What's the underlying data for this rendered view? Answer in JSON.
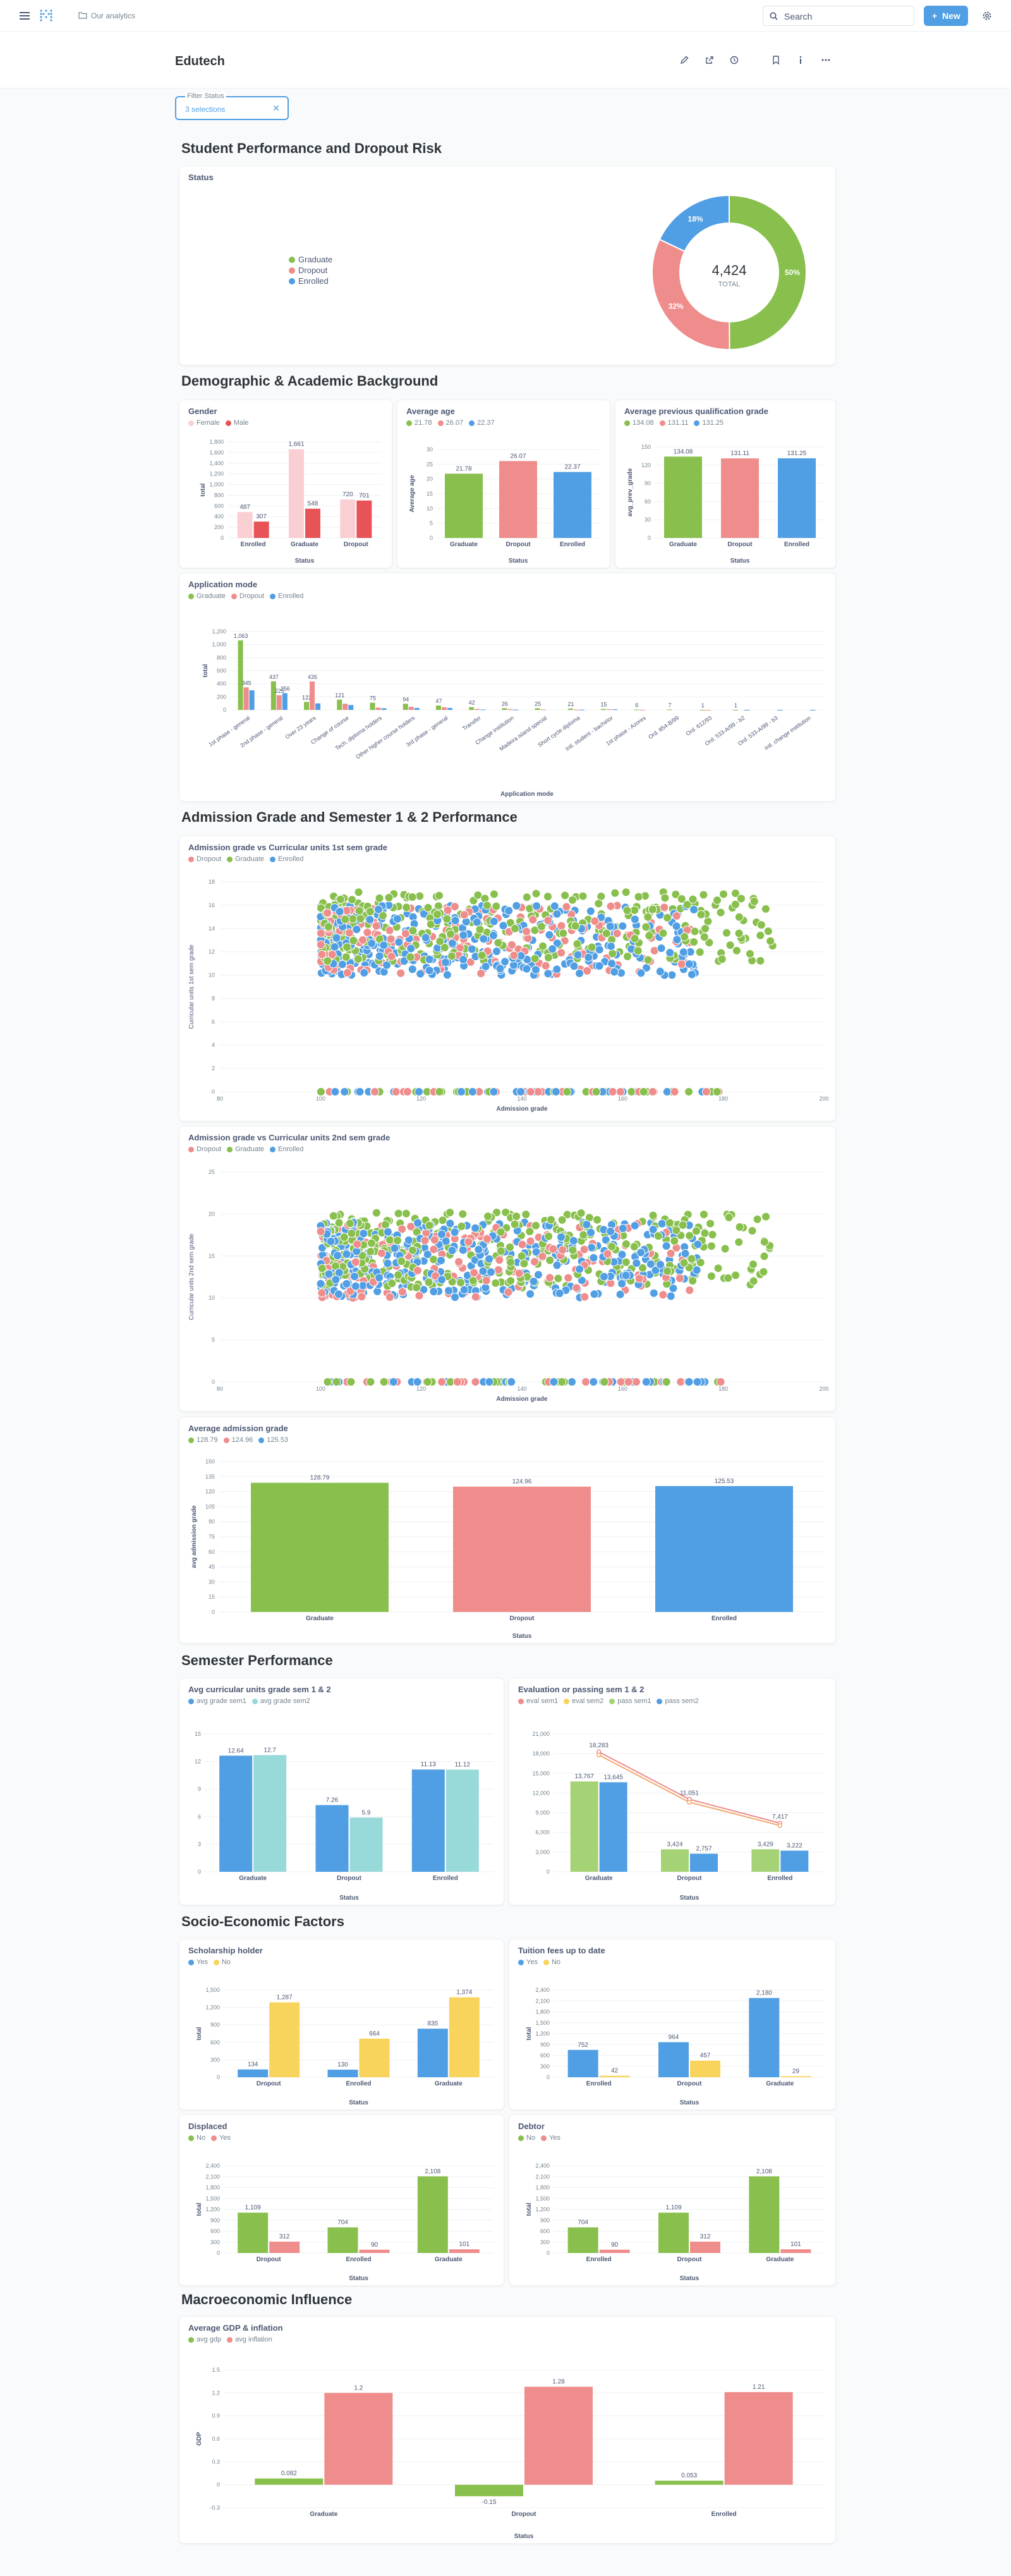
{
  "nav": {
    "breadcrumb": "Our analytics",
    "search_label": "Search",
    "new_label": "New",
    "logo_icon": "metabase-logo-icon",
    "menu_icon": "hamburger-icon",
    "settings_icon": "gear-icon",
    "folder_icon": "folder-icon"
  },
  "dashboard": {
    "title": "Edutech",
    "icons": [
      "pencil-icon",
      "share-icon",
      "clock-icon",
      "bookmark-icon",
      "info-icon",
      "more-icon"
    ]
  },
  "filter": {
    "label": "Filter Status",
    "value": "3 selections",
    "clear_icon": "close-icon"
  },
  "colors": {
    "graduate": "#88bf4d",
    "dropout": "#ef8c8c",
    "enrolled": "#509ee3",
    "enrolled_light": "#98d9d9",
    "female": "#f9cfd3",
    "male": "#e75356",
    "yes": "#509ee3",
    "no": "#f9d45c",
    "yes_green": "#88bf4d",
    "no_red": "#ef8c8c"
  },
  "sections": {
    "s1": "Student Performance and Dropout Risk",
    "s2": "Demographic & Academic Background",
    "s3": "Admission Grade and Semester 1 & 2 Performance",
    "s4": "Semester Performance",
    "s5": "Socio-Economic Factors",
    "s6": "Macroeconomic Influence"
  },
  "charts": [
    {
      "id": "status",
      "title": "Status",
      "type": "pie",
      "labels": [
        "Graduate",
        "Dropout",
        "Enrolled"
      ],
      "values": [
        2209,
        1421,
        794
      ],
      "percent_labels": [
        "50%",
        "32%",
        "18%"
      ],
      "total": "4,424",
      "total_label": "TOTAL"
    },
    {
      "id": "gender",
      "title": "Gender",
      "type": "bar",
      "legend": [
        "Female",
        "Male"
      ],
      "categories": [
        "Enrolled",
        "Graduate",
        "Dropout"
      ],
      "series": [
        {
          "name": "Female",
          "values": [
            487,
            1661,
            720
          ]
        },
        {
          "name": "Male",
          "values": [
            307,
            548,
            701
          ]
        }
      ],
      "value_labels": [
        [
          "487",
          "1,661",
          "720"
        ],
        [
          "307",
          "548",
          "701"
        ]
      ],
      "yticks": [
        0,
        200,
        400,
        600,
        800,
        1000,
        1200,
        1400,
        1600,
        1800
      ],
      "ytick_labels": [
        "0",
        "200",
        "400",
        "600",
        "800",
        "1,000",
        "1,200",
        "1,400",
        "1,600",
        "1,800"
      ],
      "ylabel": "total",
      "xlabel": "Status"
    },
    {
      "id": "avg_age",
      "title": "Average age",
      "type": "bar",
      "legend": [
        "21.78",
        "26.07",
        "22.37"
      ],
      "categories": [
        "Graduate",
        "Dropout",
        "Enrolled"
      ],
      "values": [
        21.78,
        26.07,
        22.37
      ],
      "value_labels": [
        "21.78",
        "26.07",
        "22.37"
      ],
      "yticks": [
        0,
        5,
        10,
        15,
        20,
        25,
        30
      ],
      "ylabel": "Average age",
      "xlabel": "Status"
    },
    {
      "id": "prev_qual",
      "title": "Average previous qualification grade",
      "type": "bar",
      "legend": [
        "134.08",
        "131.11",
        "131.25"
      ],
      "categories": [
        "Graduate",
        "Dropout",
        "Enrolled"
      ],
      "values": [
        134.08,
        131.11,
        131.25
      ],
      "value_labels": [
        "134.08",
        "131.11",
        "131.25"
      ],
      "yticks": [
        0,
        30,
        60,
        90,
        120,
        150
      ],
      "ylabel": "avg_prev_grade",
      "xlabel": "Status"
    },
    {
      "id": "app_mode",
      "title": "Application mode",
      "type": "bar",
      "legend": [
        "Graduate",
        "Dropout",
        "Enrolled"
      ],
      "categories": [
        "1st phase - general",
        "2nd phase - general",
        "Over 23 years",
        "Change of course",
        "Tech. diploma holders",
        "Other higher course holders",
        "3rd phase - general",
        "Transfer",
        "Change institution",
        "Madeira island special",
        "Short cycle diploma",
        "Intl. student - bachelor",
        "1st phase - Azores",
        "Ord. 854-B/99",
        "Ord. 612/93",
        "Ord. 533-A/99 - b2",
        "Ord. 533-A/99 - b3",
        "Intl. change institution"
      ],
      "series": [
        {
          "name": "Graduate",
          "values": [
            1063,
            437,
            122,
            157,
            110,
            94,
            67,
            42,
            26,
            25,
            21,
            15,
            6,
            7,
            1,
            1,
            0,
            0
          ]
        },
        {
          "name": "Dropout",
          "values": [
            345,
            225,
            435,
            95,
            35,
            47,
            41,
            14,
            13,
            7,
            4,
            10,
            2,
            0,
            1,
            0,
            0,
            0
          ]
        },
        {
          "name": "Enrolled",
          "values": [
            300,
            256,
            100,
            75,
            25,
            30,
            30,
            6,
            4,
            0,
            3,
            10,
            0,
            0,
            0,
            1,
            1,
            1
          ]
        }
      ],
      "value_labels": {
        "1063": "1,063",
        "345": "345",
        "437": "437",
        "256": "256",
        "435": "435",
        "225": "225",
        "122": "122",
        "157": "121",
        "110": "75",
        "94": "94",
        "67": "47",
        "42": "42",
        "26": "26",
        "25": "25",
        "21": "21",
        "15": "15",
        "6": "6",
        "7": "7",
        "1": "1"
      },
      "yticks": [
        0,
        200,
        400,
        600,
        800,
        1000,
        1200
      ],
      "ytick_labels": [
        "0",
        "200",
        "400",
        "600",
        "800",
        "1,000",
        "1,200"
      ],
      "ylabel": "total",
      "xlabel": "Application mode"
    },
    {
      "id": "scatter1",
      "title": "Admission grade vs Curricular units 1st sem grade",
      "type": "scatter",
      "legend": [
        "Dropout",
        "Graduate",
        "Enrolled"
      ],
      "xlabel": "Admission grade",
      "ylabel": "Curricular units 1st sem grade",
      "xlim": [
        80,
        200
      ],
      "ylim": [
        0,
        18
      ],
      "xticks": [
        80,
        100,
        120,
        140,
        160,
        180,
        200
      ],
      "yticks": [
        0,
        2,
        4,
        6,
        8,
        10,
        12,
        14,
        16,
        18
      ],
      "note": "point cloud mainly at admission 100-190, grade 10-17, plus row at 0"
    },
    {
      "id": "scatter2",
      "title": "Admission grade vs Curricular units 2nd sem grade",
      "type": "scatter",
      "legend": [
        "Dropout",
        "Graduate",
        "Enrolled"
      ],
      "xlabel": "Admission grade",
      "ylabel": "Curricular units 2nd sem grade",
      "xlim": [
        80,
        200
      ],
      "ylim": [
        0,
        25
      ],
      "xticks": [
        80,
        100,
        120,
        140,
        160,
        180,
        200
      ],
      "yticks": [
        0,
        5,
        10,
        15,
        20,
        25
      ]
    },
    {
      "id": "avg_adm",
      "title": "Average admission grade",
      "type": "bar",
      "legend": [
        "128.79",
        "124.96",
        "125.53"
      ],
      "categories": [
        "Graduate",
        "Dropout",
        "Enrolled"
      ],
      "values": [
        128.79,
        124.96,
        125.53
      ],
      "value_labels": [
        "128.79",
        "124.96",
        "125.53"
      ],
      "yticks": [
        0,
        15,
        30,
        45,
        60,
        75,
        90,
        105,
        120,
        135,
        150
      ],
      "ylabel": "avg admission grade",
      "xlabel": "Status"
    },
    {
      "id": "sem_grade",
      "title": "Avg curricular units grade sem 1 & 2",
      "type": "bar",
      "legend": [
        "avg grade sem1",
        "avg grade sem2"
      ],
      "categories": [
        "Graduate",
        "Dropout",
        "Enrolled"
      ],
      "series": [
        {
          "name": "avg grade sem1",
          "values": [
            12.64,
            7.26,
            11.13
          ]
        },
        {
          "name": "avg grade sem2",
          "values": [
            12.7,
            5.9,
            11.12
          ]
        }
      ],
      "value_labels": [
        [
          "12.64",
          "7.26",
          "11.13"
        ],
        [
          "12.7",
          "5.9",
          "11.12"
        ]
      ],
      "yticks": [
        0,
        3,
        6,
        9,
        12,
        15
      ],
      "xlabel": "Status"
    },
    {
      "id": "eval_pass",
      "title": "Evaluation or passing sem 1 & 2",
      "type": "combo",
      "legend": [
        "eval sem1",
        "eval sem2",
        "pass sem1",
        "pass sem2"
      ],
      "categories": [
        "Graduate",
        "Dropout",
        "Enrolled"
      ],
      "lines": [
        {
          "name": "eval sem1",
          "values": [
            18283,
            11051,
            7417
          ]
        },
        {
          "name": "eval sem2",
          "values": [
            17800,
            10600,
            7050
          ]
        }
      ],
      "bars": [
        {
          "name": "pass sem1",
          "values": [
            13767,
            3424,
            3429
          ]
        },
        {
          "name": "pass sem2",
          "values": [
            13645,
            2757,
            3222
          ]
        }
      ],
      "value_labels": {
        "lines": [
          "18,283",
          "11,051",
          "7,417"
        ],
        "bars1": [
          "13,767",
          "3,424",
          "3,429"
        ],
        "bars2": [
          "13,645",
          "2,757",
          "3,222"
        ]
      },
      "yticks": [
        0,
        3000,
        6000,
        9000,
        12000,
        15000,
        18000,
        21000
      ],
      "ytick_labels": [
        "0",
        "3,000",
        "6,000",
        "9,000",
        "12,000",
        "15,000",
        "18,000",
        "21,000"
      ],
      "xlabel": "Status"
    },
    {
      "id": "scholar",
      "title": "Scholarship holder",
      "type": "bar",
      "legend": [
        "Yes",
        "No"
      ],
      "categories": [
        "Dropout",
        "Enrolled",
        "Graduate"
      ],
      "series": [
        {
          "name": "Yes",
          "values": [
            134,
            130,
            835
          ]
        },
        {
          "name": "No",
          "values": [
            1287,
            664,
            1374
          ]
        }
      ],
      "value_labels": [
        [
          "134",
          "130",
          "835"
        ],
        [
          "1,287",
          "664",
          "1,374"
        ]
      ],
      "yticks": [
        0,
        300,
        600,
        900,
        1200,
        1500
      ],
      "ytick_labels": [
        "0",
        "300",
        "600",
        "900",
        "1,200",
        "1,500"
      ],
      "ylabel": "total",
      "xlabel": "Status"
    },
    {
      "id": "tuition",
      "title": "Tuition fees up to date",
      "type": "bar",
      "legend": [
        "Yes",
        "No"
      ],
      "categories": [
        "Enrolled",
        "Dropout",
        "Graduate"
      ],
      "series": [
        {
          "name": "Yes",
          "values": [
            752,
            964,
            2180
          ]
        },
        {
          "name": "No",
          "values": [
            42,
            457,
            29
          ]
        }
      ],
      "value_labels": [
        [
          "752",
          "964",
          "2,180"
        ],
        [
          "42",
          "457",
          "29"
        ]
      ],
      "yticks": [
        0,
        300,
        600,
        900,
        1200,
        1500,
        1800,
        2100,
        2400
      ],
      "ytick_labels": [
        "0",
        "300",
        "600",
        "900",
        "1,200",
        "1,500",
        "1,800",
        "2,100",
        "2,400"
      ],
      "ylabel": "total",
      "xlabel": "Status"
    },
    {
      "id": "displaced",
      "title": "Displaced",
      "type": "bar",
      "legend": [
        "No",
        "Yes"
      ],
      "categories": [
        "Dropout",
        "Enrolled",
        "Graduate"
      ],
      "series": [
        {
          "name": "No",
          "values": [
            1109,
            704,
            2108
          ]
        },
        {
          "name": "Yes",
          "values": [
            312,
            90,
            101
          ]
        }
      ],
      "value_labels": [
        [
          "1,109",
          "704",
          "2,108"
        ],
        [
          "312",
          "90",
          "101"
        ]
      ],
      "yticks": [
        0,
        300,
        600,
        900,
        1200,
        1500,
        1800,
        2100,
        2400
      ],
      "ytick_labels": [
        "0",
        "300",
        "600",
        "900",
        "1,200",
        "1,500",
        "1,800",
        "2,100",
        "2,400"
      ],
      "ylabel": "total",
      "xlabel": "Status"
    },
    {
      "id": "debtor",
      "title": "Debtor",
      "type": "bar",
      "legend": [
        "No",
        "Yes"
      ],
      "categories": [
        "Enrolled",
        "Dropout",
        "Graduate"
      ],
      "series": [
        {
          "name": "No",
          "values": [
            704,
            1109,
            2108
          ]
        },
        {
          "name": "Yes",
          "values": [
            90,
            312,
            101
          ]
        }
      ],
      "value_labels": [
        [
          "704",
          "1,109",
          "2,108"
        ],
        [
          "90",
          "312",
          "101"
        ]
      ],
      "yticks": [
        0,
        300,
        600,
        900,
        1200,
        1500,
        1800,
        2100,
        2400
      ],
      "ytick_labels": [
        "0",
        "300",
        "600",
        "900",
        "1,200",
        "1,500",
        "1,800",
        "2,100",
        "2,400"
      ],
      "ylabel": "total",
      "xlabel": "Status"
    },
    {
      "id": "gdp",
      "title": "Average GDP & inflation",
      "type": "bar",
      "legend": [
        "avg gdp",
        "avg inflation"
      ],
      "categories": [
        "Graduate",
        "Dropout",
        "Enrolled"
      ],
      "series": [
        {
          "name": "avg gdp",
          "values": [
            0.082,
            -0.15,
            0.053
          ]
        },
        {
          "name": "avg inflation",
          "values": [
            1.2,
            1.28,
            1.21
          ]
        }
      ],
      "value_labels": [
        [
          "0.082",
          "-0.15",
          "0.053"
        ],
        [
          "1.2",
          "1.28",
          "1.21"
        ]
      ],
      "yticks": [
        -0.3,
        0,
        0.3,
        0.6,
        0.9,
        1.2,
        1.5
      ],
      "ytick_labels": [
        "-0.3",
        "0",
        "0.3",
        "0.6",
        "0.9",
        "1.2",
        "1.5"
      ],
      "ylabel": "GDP",
      "xlabel": "Status"
    }
  ]
}
